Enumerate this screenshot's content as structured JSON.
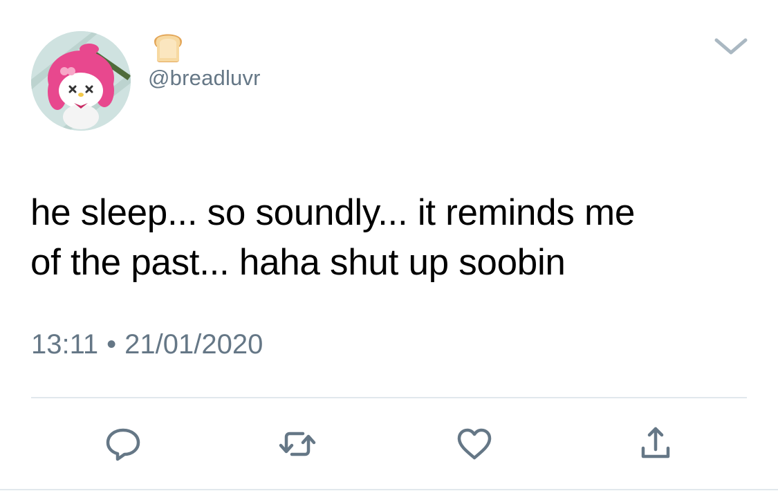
{
  "tweet": {
    "handle": "@breadluvr",
    "display_name_icon": "bread-emoji",
    "text": "he sleep... so soundly... it reminds me\nof the past... haha shut up soobin",
    "time": "13:11",
    "separator": "•",
    "date": "21/01/2020"
  },
  "avatar": {
    "icon": "my-melody-avatar",
    "accent_color": "#e8488e"
  },
  "menu": {
    "icon": "chevron-down-icon"
  },
  "actions": [
    {
      "name": "reply",
      "icon": "reply-icon"
    },
    {
      "name": "retweet",
      "icon": "retweet-icon"
    },
    {
      "name": "like",
      "icon": "heart-icon"
    },
    {
      "name": "share",
      "icon": "share-icon"
    }
  ],
  "colors": {
    "text": "#000000",
    "secondary": "#657786",
    "icon": "#657786",
    "divider": "#e1e8ed"
  }
}
